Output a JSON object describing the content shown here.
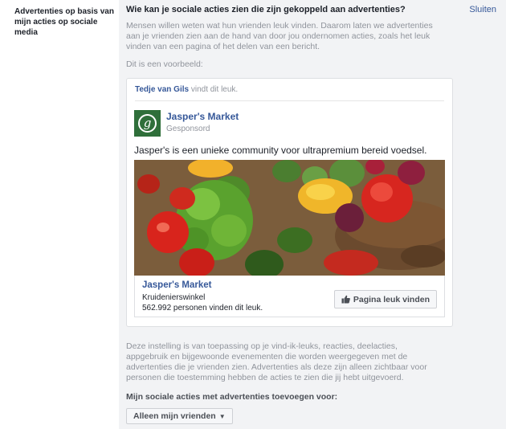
{
  "left": {
    "label": "Advertenties op basis van mijn acties op sociale media"
  },
  "section": {
    "heading": "Wie kan je sociale acties zien die zijn gekoppeld aan advertenties?",
    "close_label": "Sluiten",
    "description": "Mensen willen weten wat hun vrienden leuk vinden. Daarom laten we advertenties aan je vrienden zien aan de hand van door jou ondernomen acties, zoals het leuk vinden van een pagina of het delen van een bericht.",
    "example_label": "Dit is een voorbeeld:"
  },
  "ad": {
    "social_name": "Tedje van Gils",
    "social_action": "vindt dit leuk.",
    "logo_letter": "g",
    "page_name": "Jasper's Market",
    "sponsored": "Gesponsord",
    "text": "Jasper's is een unieke community voor ultrapremium bereid voedsel.",
    "image_icon": "vegetables-photo",
    "footer": {
      "name": "Jasper's Market",
      "category": "Kruidenierswinkel",
      "likes": "562.992 personen vinden dit leuk.",
      "like_button": "Pagina leuk vinden",
      "like_icon": "thumbs-up-icon"
    }
  },
  "note": "Deze instelling is van toepassing op je vind-ik-leuks, reacties, deelacties, appgebruik en bijgewoonde evenementen die worden weergegeven met de advertenties die je vrienden zien. Advertenties als deze zijn alleen zichtbaar voor personen die toestemming hebben de acties te zien die jij hebt uitgevoerd.",
  "audience": {
    "label": "Mijn sociale acties met advertenties toevoegen voor:",
    "selected": "Alleen mijn vrienden"
  },
  "colors": {
    "link": "#365899",
    "background": "#f2f3f5",
    "muted_text": "#90949c",
    "logo_green": "#2f6f3a"
  }
}
